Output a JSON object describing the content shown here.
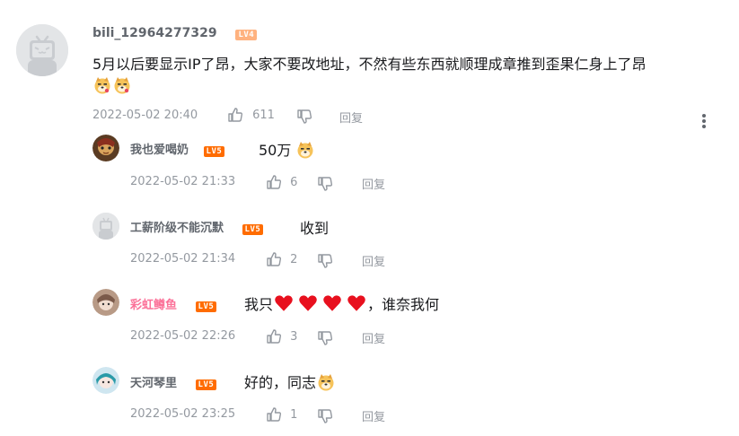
{
  "main_comment": {
    "username": "bili_12964277329",
    "level": "LV4",
    "text": "5月以后要显示IP了昂，大家不要改地址，不然有些东西就顺理成章推到歪果仁身上了昂",
    "time": "2022-05-02 20:40",
    "likes": "611",
    "reply_label": "回复",
    "emojis": [
      "doge-emoji",
      "doge-emoji"
    ]
  },
  "replies": [
    {
      "username": "我也爱喝奶",
      "level": "LV5",
      "text": "50万",
      "time": "2022-05-02 21:33",
      "likes": "6",
      "reply_label": "回复"
    },
    {
      "username": "工薪阶级不能沉默",
      "level": "LV5",
      "text": "收到",
      "time": "2022-05-02 21:34",
      "likes": "2",
      "reply_label": "回复"
    },
    {
      "username": "彩虹鳟鱼",
      "level": "LV5",
      "text_before": "我只",
      "text_after": "，谁奈我何",
      "time": "2022-05-02 22:26",
      "likes": "3",
      "reply_label": "回复"
    },
    {
      "username": "天河琴里",
      "level": "LV5",
      "text": "好的，同志",
      "time": "2022-05-02 23:25",
      "likes": "1",
      "reply_label": "回复"
    }
  ],
  "colors": {
    "username": "#61666d",
    "vip_username": "#fb7299",
    "meta": "#9499a0",
    "lv4": "#ffb27f",
    "lv5": "#ff6c00"
  }
}
